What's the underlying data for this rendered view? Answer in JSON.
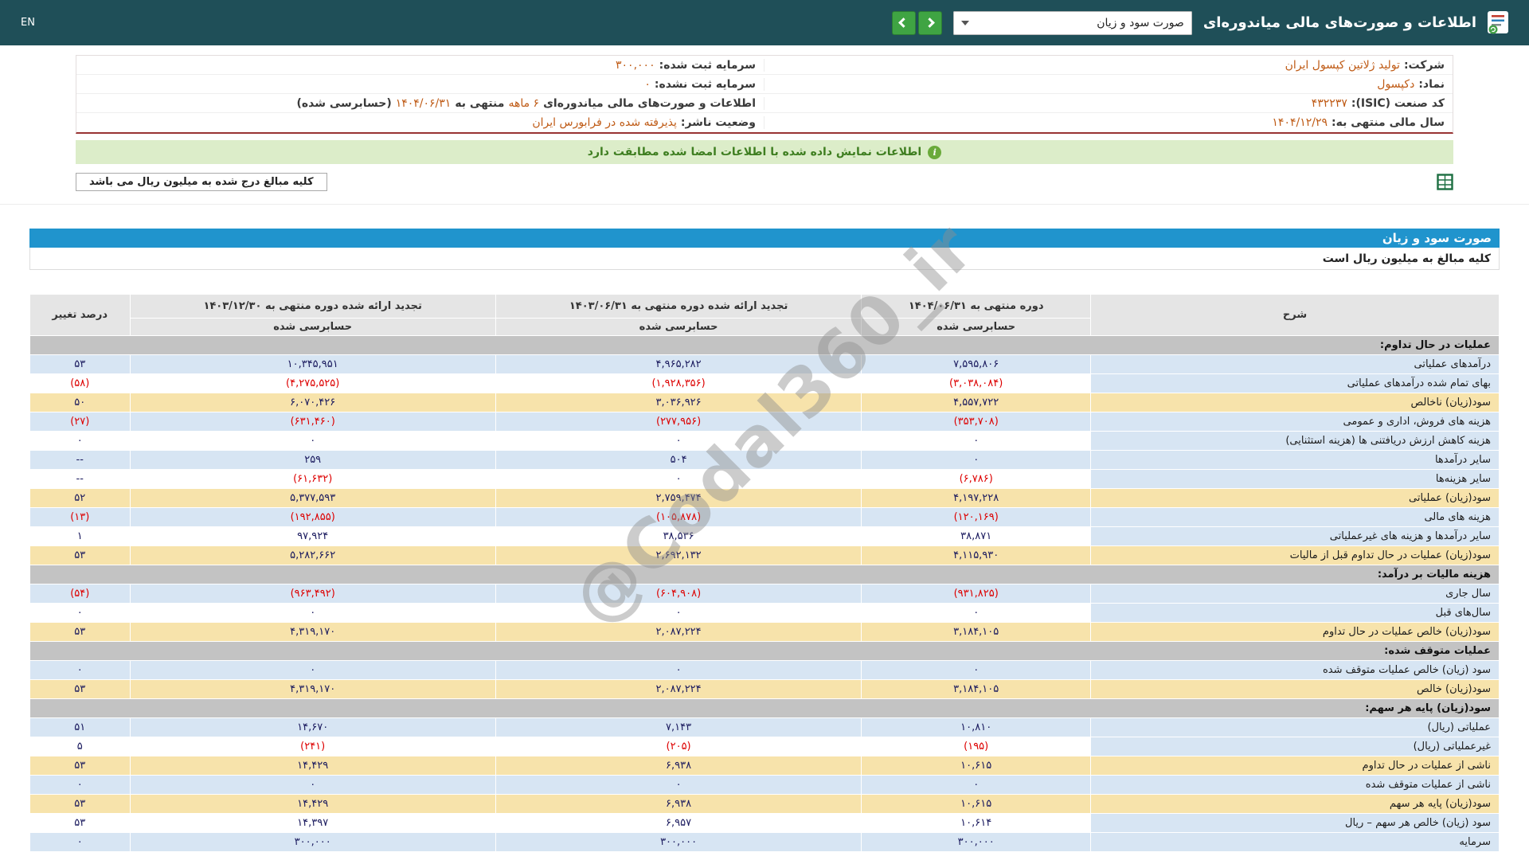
{
  "colors": {
    "topbar_bg": "#1f4f58",
    "nav_button_green": "#3fa443",
    "title_bar_blue": "#2094cd",
    "banner_bg": "#dcedc9",
    "banner_text": "#3e7e20",
    "value_orange": "#bf5b16",
    "row_blue": "#d7e5f3",
    "row_yellow": "#f7e3ab",
    "section_bg": "#c3c3c3",
    "header_bg": "#e5e5e5",
    "negative_red": "#dd0000",
    "number_color": "#1a1a5e",
    "maroon_border": "#993333"
  },
  "icons": {
    "report": "document-with-green-badge",
    "dropdown_caret": "chevron-down-triangle",
    "nav_back": "chevron-left",
    "nav_forward": "chevron-right",
    "banner_info": "green-circle-i",
    "excel_export": "green-spreadsheet-grid"
  },
  "topbar": {
    "title": "اطلاعات و صورت‌های مالی میاندوره‌ای",
    "dropdown_value": "صورت سود و زیان",
    "en_label": "EN"
  },
  "company_info": {
    "rows": [
      {
        "right": {
          "label": "شرکت:",
          "value": "تولید ژلاتین کپسول ایران"
        },
        "left": {
          "label": "سرمایه ثبت شده:",
          "value": "۳۰۰,۰۰۰"
        }
      },
      {
        "right": {
          "label": "نماد:",
          "value": "دکپسول"
        },
        "left": {
          "label": "سرمایه ثبت نشده:",
          "value": "۰"
        }
      },
      {
        "right": {
          "label": "کد صنعت (ISIC):",
          "value": "۴۳۲۲۳۷"
        },
        "left": {
          "segments": [
            {
              "text": "اطلاعات و صورت‌های مالی میاندوره‌ای",
              "highlight": false
            },
            {
              "text": "۶ ماهه",
              "highlight": true
            },
            {
              "text": "منتهی به",
              "highlight": false
            },
            {
              "text": "۱۴۰۴/۰۶/۳۱",
              "highlight": true
            },
            {
              "text": "(حسابرسی شده)",
              "highlight": false
            }
          ]
        }
      },
      {
        "right": {
          "label": "سال مالی منتهی به:",
          "value": "۱۴۰۴/۱۲/۲۹"
        },
        "left": {
          "label": "وضعیت ناشر:",
          "value": "پذیرفته شده در فرابورس ایران"
        }
      }
    ]
  },
  "banner": {
    "message": "اطلاعات نمایش داده شده با اطلاعات امضا شده مطابقت دارد"
  },
  "note": {
    "text": "کلیه مبالغ درج شده به میلیون ریال می باشد"
  },
  "statement": {
    "title": "صورت سود و زیان",
    "subtitle": "کلیه مبالغ به میلیون ریال است",
    "watermark": "@Codal360_ir",
    "header": {
      "desc": "شرح",
      "pct": "درصد تغییر",
      "audited": "حسابرسی شده",
      "periods": [
        "دوره منتهی به ۱۴۰۴/۰۶/۳۱",
        "تجدید ارائه شده دوره منتهی به ۱۴۰۳/۰۶/۳۱",
        "تجدید ارائه شده دوره منتهی به ۱۴۰۳/۱۲/۳۰"
      ]
    },
    "rows": [
      {
        "tone": "section",
        "label": "عملیات در حال تداوم:"
      },
      {
        "tone": "blue",
        "label": "درآمدهای عملیاتی",
        "v1": "۷,۵۹۵,۸۰۶",
        "v2": "۴,۹۶۵,۲۸۲",
        "v3": "۱۰,۳۴۵,۹۵۱",
        "pct": "۵۳"
      },
      {
        "tone": "white",
        "label": "بهای تمام شده درآمدهای عملیاتی",
        "v1": "(۳,۰۳۸,۰۸۴)",
        "v2": "(۱,۹۲۸,۳۵۶)",
        "v3": "(۴,۲۷۵,۵۲۵)",
        "pct": "(۵۸)"
      },
      {
        "tone": "yellow",
        "label": "سود(زیان) ناخالص",
        "v1": "۴,۵۵۷,۷۲۲",
        "v2": "۳,۰۳۶,۹۲۶",
        "v3": "۶,۰۷۰,۴۲۶",
        "pct": "۵۰"
      },
      {
        "tone": "blue",
        "label": "هزینه های فروش، اداری و عمومی",
        "v1": "(۳۵۳,۷۰۸)",
        "v2": "(۲۷۷,۹۵۶)",
        "v3": "(۶۳۱,۴۶۰)",
        "pct": "(۲۷)"
      },
      {
        "tone": "white",
        "label": "هزینه کاهش ارزش دریافتنی ها (هزینه استثنایی)",
        "v1": "۰",
        "v2": "۰",
        "v3": "۰",
        "pct": "۰"
      },
      {
        "tone": "blue",
        "label": "سایر درآمدها",
        "v1": "۰",
        "v2": "۵۰۴",
        "v3": "۲۵۹",
        "pct": "--"
      },
      {
        "tone": "white",
        "label": "سایر هزینه‌ها",
        "v1": "(۶,۷۸۶)",
        "v2": "۰",
        "v3": "(۶۱,۶۳۲)",
        "pct": "--"
      },
      {
        "tone": "yellow",
        "label": "سود(زیان) عملیاتی",
        "v1": "۴,۱۹۷,۲۲۸",
        "v2": "۲,۷۵۹,۴۷۴",
        "v3": "۵,۳۷۷,۵۹۳",
        "pct": "۵۲"
      },
      {
        "tone": "blue",
        "label": "هزینه های مالی",
        "v1": "(۱۲۰,۱۶۹)",
        "v2": "(۱۰۵,۸۷۸)",
        "v3": "(۱۹۲,۸۵۵)",
        "pct": "(۱۳)"
      },
      {
        "tone": "white",
        "label": "سایر درآمدها و هزینه های غیرعملیاتی",
        "v1": "۳۸,۸۷۱",
        "v2": "۳۸,۵۳۶",
        "v3": "۹۷,۹۲۴",
        "pct": "۱"
      },
      {
        "tone": "yellow",
        "label": "سود(زیان) عملیات در حال تداوم قبل از مالیات",
        "v1": "۴,۱۱۵,۹۳۰",
        "v2": "۲,۶۹۲,۱۳۲",
        "v3": "۵,۲۸۲,۶۶۲",
        "pct": "۵۳"
      },
      {
        "tone": "section",
        "label": "هزینه مالیات بر درآمد:"
      },
      {
        "tone": "blue",
        "label": "سال جاری",
        "v1": "(۹۳۱,۸۲۵)",
        "v2": "(۶۰۴,۹۰۸)",
        "v3": "(۹۶۳,۴۹۲)",
        "pct": "(۵۴)"
      },
      {
        "tone": "white",
        "label": "سال‌های قبل",
        "v1": "۰",
        "v2": "۰",
        "v3": "۰",
        "pct": "۰"
      },
      {
        "tone": "yellow",
        "label": "سود(زیان) خالص عملیات در حال تداوم",
        "v1": "۳,۱۸۴,۱۰۵",
        "v2": "۲,۰۸۷,۲۲۴",
        "v3": "۴,۳۱۹,۱۷۰",
        "pct": "۵۳"
      },
      {
        "tone": "section",
        "label": "عملیات متوقف شده:"
      },
      {
        "tone": "blue",
        "label": "سود (زیان) خالص عملیات متوقف شده",
        "v1": "۰",
        "v2": "۰",
        "v3": "۰",
        "pct": "۰"
      },
      {
        "tone": "yellow",
        "label": "سود(زیان) خالص",
        "v1": "۳,۱۸۴,۱۰۵",
        "v2": "۲,۰۸۷,۲۲۴",
        "v3": "۴,۳۱۹,۱۷۰",
        "pct": "۵۳"
      },
      {
        "tone": "section",
        "label": "سود(زیان) پایه هر سهم:"
      },
      {
        "tone": "blue",
        "label": "عملیاتی (ریال)",
        "v1": "۱۰,۸۱۰",
        "v2": "۷,۱۴۳",
        "v3": "۱۴,۶۷۰",
        "pct": "۵۱"
      },
      {
        "tone": "white",
        "label": "غیرعملیاتی (ریال)",
        "v1": "(۱۹۵)",
        "v2": "(۲۰۵)",
        "v3": "(۲۴۱)",
        "pct": "۵"
      },
      {
        "tone": "yellow",
        "label": "ناشی از عملیات در حال تداوم",
        "v1": "۱۰,۶۱۵",
        "v2": "۶,۹۳۸",
        "v3": "۱۴,۴۲۹",
        "pct": "۵۳"
      },
      {
        "tone": "blue",
        "label": "ناشی از عملیات متوقف شده",
        "v1": "۰",
        "v2": "۰",
        "v3": "۰",
        "pct": "۰"
      },
      {
        "tone": "yellow",
        "label": "سود(زیان) پایه هر سهم",
        "v1": "۱۰,۶۱۵",
        "v2": "۶,۹۳۸",
        "v3": "۱۴,۴۲۹",
        "pct": "۵۳"
      },
      {
        "tone": "white",
        "label": "سود (زیان) خالص هر سهم – ریال",
        "v1": "۱۰,۶۱۴",
        "v2": "۶,۹۵۷",
        "v3": "۱۴,۳۹۷",
        "pct": "۵۳"
      },
      {
        "tone": "blue",
        "label": "سرمایه",
        "v1": "۳۰۰,۰۰۰",
        "v2": "۳۰۰,۰۰۰",
        "v3": "۳۰۰,۰۰۰",
        "pct": "۰"
      }
    ]
  }
}
